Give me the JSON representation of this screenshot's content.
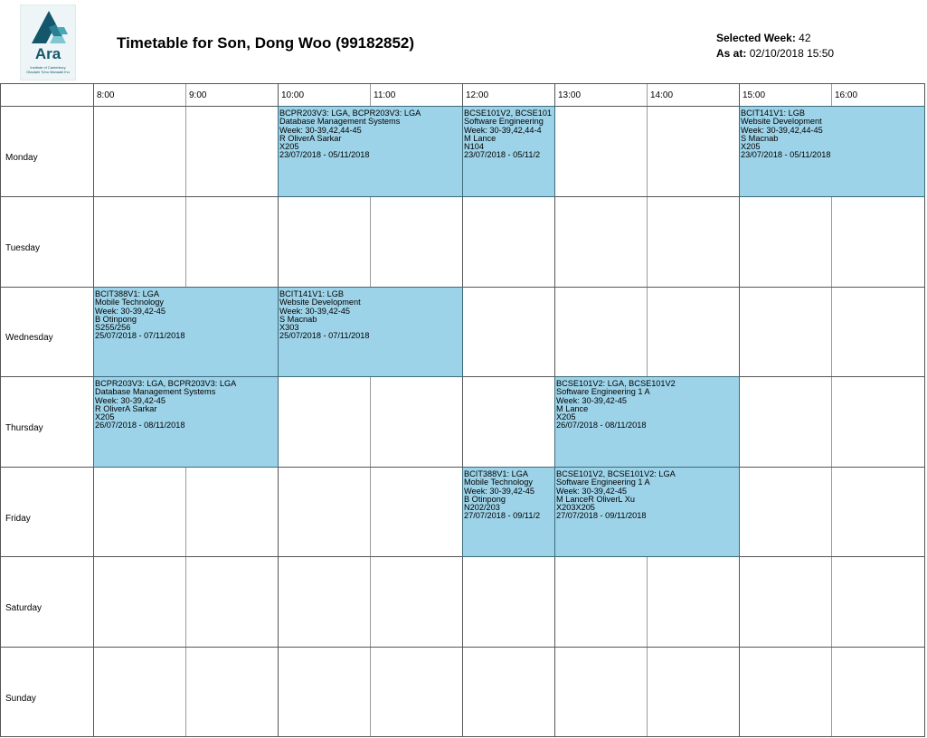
{
  "logo": {
    "name": "Ara",
    "sub1": "Institute of Canterbury",
    "sub2": "Otautahi Tohu Manaaki Ihu"
  },
  "title": "Timetable for Son, Dong Woo (99182852)",
  "selected_week": {
    "label": "Selected Week:",
    "value": "42"
  },
  "as_at": {
    "label": "As at:",
    "value": "02/10/2018 15:50"
  },
  "times": [
    "8:00",
    "9:00",
    "10:00",
    "11:00",
    "12:00",
    "13:00",
    "14:00",
    "15:00",
    "16:00"
  ],
  "days": [
    "Monday",
    "Tuesday",
    "Wednesday",
    "Thursday",
    "Friday",
    "Saturday",
    "Sunday"
  ],
  "sessions": [
    {
      "lines": [
        "BCPR203V3: LGA, BCPR203V3: LGA",
        "Database Management Systems",
        "Week: 30-39,42,44-45",
        "R OliverA Sarkar",
        "X205",
        "23/07/2018 - 05/11/2018"
      ]
    },
    {
      "lines": [
        "BCSE101V2, BCSE101",
        "Software Engineering",
        "Week: 30-39,42,44-4",
        "M Lance",
        "N104",
        "23/07/2018 - 05/11/2"
      ]
    },
    {
      "lines": [
        "BCIT141V1: LGB",
        "Website Development",
        "Week: 30-39,42,44-45",
        "S Macnab",
        "X205",
        "23/07/2018 - 05/11/2018"
      ]
    },
    {
      "lines": [
        "BCIT388V1: LGA",
        "Mobile Technology",
        "Week: 30-39,42-45",
        "B Otinpong",
        "S255/256",
        "25/07/2018 - 07/11/2018"
      ]
    },
    {
      "lines": [
        "BCIT141V1: LGB",
        "Website Development",
        "Week: 30-39,42-45",
        "S Macnab",
        "X303",
        "25/07/2018 - 07/11/2018"
      ]
    },
    {
      "lines": [
        "BCPR203V3: LGA, BCPR203V3: LGA",
        "Database Management Systems",
        "Week: 30-39,42-45",
        "R OliverA Sarkar",
        "X205",
        "26/07/2018 - 08/11/2018"
      ]
    },
    {
      "lines": [
        "BCSE101V2: LGA, BCSE101V2",
        "Software Engineering 1 A",
        "Week: 30-39,42-45",
        "M Lance",
        "X205",
        "26/07/2018 - 08/11/2018"
      ]
    },
    {
      "lines": [
        "BCIT388V1: LGA",
        "Mobile Technology",
        "Week: 30-39,42-45",
        "B Otinpong",
        "N202/203",
        "27/07/2018 - 09/11/2"
      ]
    },
    {
      "lines": [
        "BCSE101V2, BCSE101V2: LGA",
        "Software Engineering 1 A",
        "Week: 30-39,42-45",
        "M LanceR OliverL Xu",
        "X203X205",
        "27/07/2018 - 09/11/2018"
      ]
    }
  ],
  "colors": {
    "session_fill": "#9dd3e8",
    "grid_line": "#555555",
    "logo_teal": "#14566c"
  }
}
